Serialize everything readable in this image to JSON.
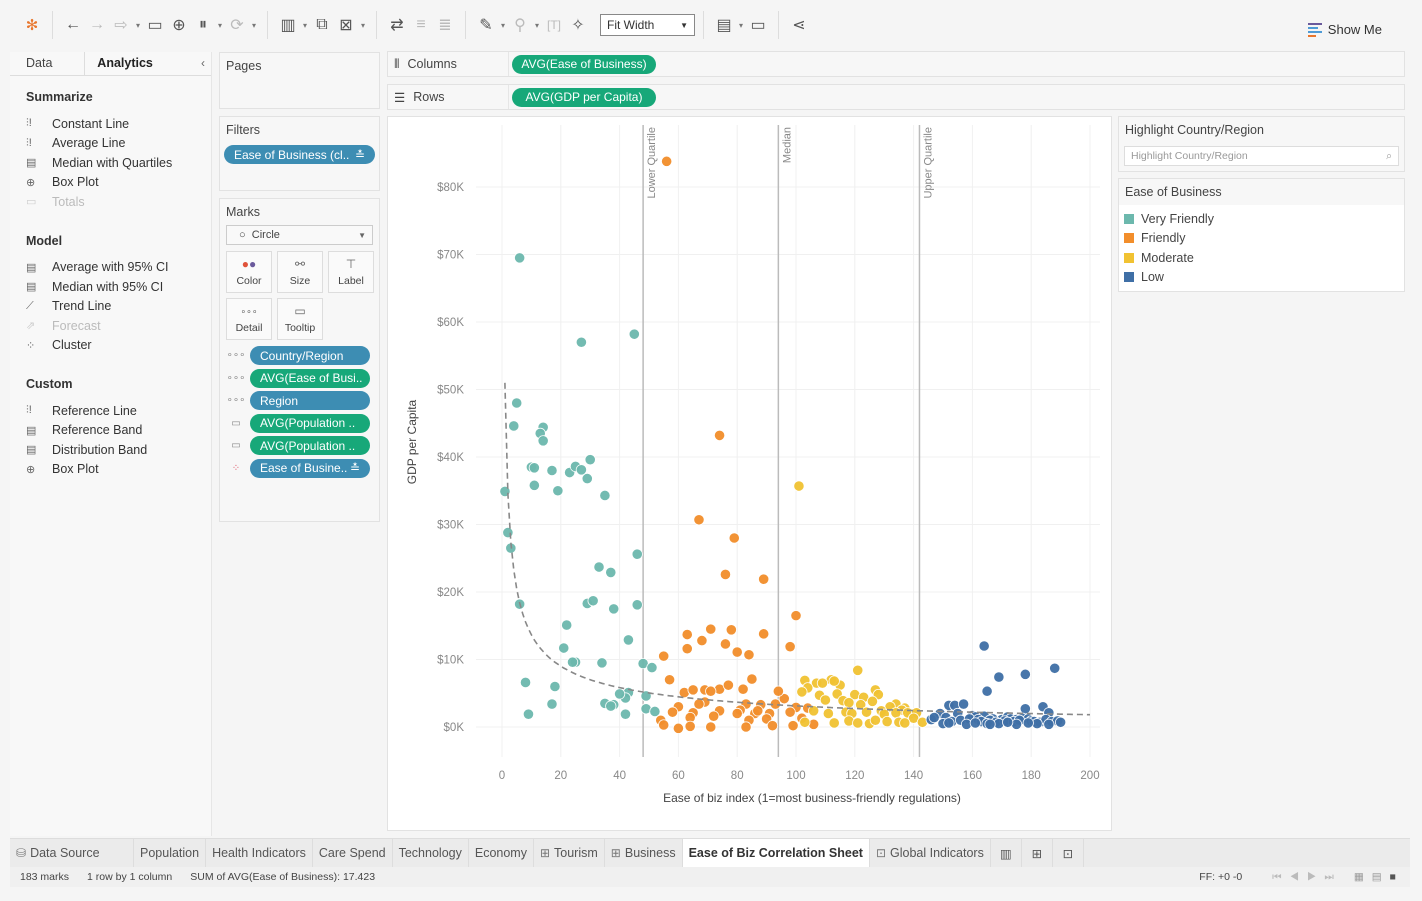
{
  "toolbar": {
    "fit_mode": "Fit Width",
    "show_me_label": "Show Me",
    "icons": [
      "tableau-logo-icon",
      "back-icon",
      "forward-icon",
      "redo-icon",
      "save-icon",
      "new-datasource-icon",
      "pause-datasource-icon",
      "refresh-icon",
      "new-worksheet-icon",
      "duplicate-sheet-icon",
      "clear-sheet-icon",
      "swap-axes-icon",
      "sort-ascending-icon",
      "sort-descending-icon",
      "highlight-icon",
      "group-icon",
      "label-text-icon",
      "pin-icon",
      "show-labels-icon",
      "presentation-icon",
      "share-icon"
    ]
  },
  "left_pane": {
    "tabs": [
      "Data",
      "Analytics"
    ],
    "sections": [
      {
        "title": "Summarize",
        "items": [
          {
            "label": "Constant Line",
            "icon": "constant-line-icon",
            "disabled": false
          },
          {
            "label": "Average Line",
            "icon": "average-line-icon",
            "disabled": false
          },
          {
            "label": "Median with Quartiles",
            "icon": "median-quartiles-icon",
            "disabled": false
          },
          {
            "label": "Box Plot",
            "icon": "box-plot-icon",
            "disabled": false
          },
          {
            "label": "Totals",
            "icon": "totals-icon",
            "disabled": true
          }
        ]
      },
      {
        "title": "Model",
        "items": [
          {
            "label": "Average with 95% CI",
            "icon": "average-ci-icon",
            "disabled": false
          },
          {
            "label": "Median with 95% CI",
            "icon": "median-ci-icon",
            "disabled": false
          },
          {
            "label": "Trend Line",
            "icon": "trend-line-icon",
            "disabled": false
          },
          {
            "label": "Forecast",
            "icon": "forecast-icon",
            "disabled": true
          },
          {
            "label": "Cluster",
            "icon": "cluster-icon",
            "disabled": false
          }
        ]
      },
      {
        "title": "Custom",
        "items": [
          {
            "label": "Reference Line",
            "icon": "reference-line-icon",
            "disabled": false
          },
          {
            "label": "Reference Band",
            "icon": "reference-band-icon",
            "disabled": false
          },
          {
            "label": "Distribution Band",
            "icon": "distribution-band-icon",
            "disabled": false
          },
          {
            "label": "Box Plot",
            "icon": "box-plot-icon",
            "disabled": false
          }
        ]
      }
    ]
  },
  "pages": {
    "title": "Pages"
  },
  "filters": {
    "title": "Filters",
    "items": [
      {
        "label": "Ease of Business (cl..",
        "color": "blue"
      }
    ]
  },
  "marks": {
    "title": "Marks",
    "type": "Circle",
    "buttons": [
      "Color",
      "Size",
      "Label",
      "Detail",
      "Tooltip"
    ],
    "fields": [
      {
        "label": "Country/Region",
        "color": "blue",
        "encoding": "detail"
      },
      {
        "label": "AVG(Ease of Busi..",
        "color": "green",
        "encoding": "detail"
      },
      {
        "label": "Region",
        "color": "blue",
        "encoding": "detail"
      },
      {
        "label": "AVG(Population ..",
        "color": "green",
        "encoding": "tooltip"
      },
      {
        "label": "AVG(Population ..",
        "color": "green",
        "encoding": "tooltip"
      },
      {
        "label": "Ease of Busine..",
        "color": "blue",
        "encoding": "color"
      }
    ]
  },
  "shelves": {
    "columns_label": "Columns",
    "columns_pill": "AVG(Ease of Business)",
    "rows_label": "Rows",
    "rows_pill": "AVG(GDP per Capita)"
  },
  "highlight": {
    "title": "Highlight Country/Region",
    "placeholder": "Highlight Country/Region"
  },
  "legend": {
    "title": "Ease of Business",
    "items": [
      {
        "label": "Very Friendly",
        "color": "#6cb8ad"
      },
      {
        "label": "Friendly",
        "color": "#f28e2b"
      },
      {
        "label": "Moderate",
        "color": "#f1c232"
      },
      {
        "label": "Low",
        "color": "#3f6fa6"
      }
    ]
  },
  "chart_data": {
    "type": "scatter",
    "title": "",
    "xlabel": "Ease of biz index (1=most business-friendly regulations)",
    "ylabel": "GDP per Capita",
    "xlim": [
      -5,
      200
    ],
    "ylim": [
      -4000,
      86000
    ],
    "x_ticks": [
      0,
      20,
      40,
      60,
      80,
      100,
      120,
      140,
      160,
      180,
      200
    ],
    "y_ticks": [
      0,
      10000,
      20000,
      30000,
      40000,
      50000,
      60000,
      70000,
      80000
    ],
    "y_tick_labels": [
      "$0K",
      "$10K",
      "$20K",
      "$30K",
      "$40K",
      "$50K",
      "$60K",
      "$70K",
      "$80K"
    ],
    "x_tick_labels": [
      "0",
      "20",
      "40",
      "60",
      "80",
      "100",
      "120",
      "140",
      "160",
      "180",
      "200"
    ],
    "grid": true,
    "reference_lines": [
      {
        "label": "Lower Quartile",
        "x": 48
      },
      {
        "label": "Median",
        "x": 94
      },
      {
        "label": "Upper Quartile",
        "x": 142
      }
    ],
    "trend_line": {
      "type": "power",
      "style": "dashed",
      "from_x": 1,
      "to_x": 200
    },
    "series": [
      {
        "name": "Very Friendly",
        "color": "#6cb8ad",
        "points": [
          [
            6,
            69500
          ],
          [
            27,
            57000
          ],
          [
            45,
            58200
          ],
          [
            5,
            48000
          ],
          [
            4,
            44600
          ],
          [
            14,
            44400
          ],
          [
            13,
            43500
          ],
          [
            14,
            42400
          ],
          [
            10,
            38500
          ],
          [
            11,
            38400
          ],
          [
            17,
            38000
          ],
          [
            23,
            37700
          ],
          [
            25,
            38600
          ],
          [
            30,
            39600
          ],
          [
            27,
            38100
          ],
          [
            29,
            36800
          ],
          [
            11,
            35800
          ],
          [
            19,
            35000
          ],
          [
            1,
            34900
          ],
          [
            35,
            34300
          ],
          [
            2,
            28800
          ],
          [
            3,
            26500
          ],
          [
            46,
            25600
          ],
          [
            33,
            23700
          ],
          [
            37,
            22900
          ],
          [
            6,
            18200
          ],
          [
            29,
            18300
          ],
          [
            31,
            18700
          ],
          [
            46,
            18100
          ],
          [
            38,
            17500
          ],
          [
            22,
            15100
          ],
          [
            43,
            12900
          ],
          [
            21,
            11700
          ],
          [
            25,
            9600
          ],
          [
            24,
            9600
          ],
          [
            34,
            9500
          ],
          [
            48,
            9400
          ],
          [
            51,
            8800
          ],
          [
            8,
            6600
          ],
          [
            18,
            6000
          ],
          [
            43,
            5100
          ],
          [
            35,
            3500
          ],
          [
            38,
            3300
          ],
          [
            42,
            4300
          ],
          [
            40,
            4900
          ],
          [
            49,
            2700
          ],
          [
            52,
            2300
          ],
          [
            9,
            1900
          ],
          [
            17,
            3400
          ],
          [
            42,
            1900
          ],
          [
            37,
            3100
          ],
          [
            49,
            4600
          ]
        ]
      },
      {
        "name": "Friendly",
        "color": "#f28e2b",
        "points": [
          [
            56,
            83800
          ],
          [
            74,
            43200
          ],
          [
            67,
            30700
          ],
          [
            79,
            28000
          ],
          [
            76,
            22600
          ],
          [
            89,
            21900
          ],
          [
            100,
            16500
          ],
          [
            71,
            14500
          ],
          [
            63,
            13700
          ],
          [
            78,
            14400
          ],
          [
            89,
            13800
          ],
          [
            68,
            12800
          ],
          [
            76,
            12300
          ],
          [
            98,
            11900
          ],
          [
            63,
            11600
          ],
          [
            80,
            11100
          ],
          [
            84,
            10700
          ],
          [
            55,
            10500
          ],
          [
            85,
            7100
          ],
          [
            57,
            7000
          ],
          [
            62,
            5100
          ],
          [
            65,
            5500
          ],
          [
            69,
            5500
          ],
          [
            74,
            5600
          ],
          [
            77,
            6200
          ],
          [
            71,
            5300
          ],
          [
            82,
            5600
          ],
          [
            69,
            3700
          ],
          [
            67,
            3400
          ],
          [
            74,
            2400
          ],
          [
            60,
            3000
          ],
          [
            83,
            3400
          ],
          [
            88,
            3300
          ],
          [
            93,
            3400
          ],
          [
            96,
            4200
          ],
          [
            100,
            2900
          ],
          [
            81,
            2500
          ],
          [
            94,
            5300
          ],
          [
            58,
            2200
          ],
          [
            65,
            2100
          ],
          [
            80,
            2000
          ],
          [
            86,
            2000
          ],
          [
            87,
            2400
          ],
          [
            91,
            2000
          ],
          [
            98,
            2200
          ],
          [
            104,
            2800
          ],
          [
            54,
            1000
          ],
          [
            64,
            1400
          ],
          [
            72,
            1600
          ],
          [
            84,
            1000
          ],
          [
            90,
            1200
          ],
          [
            102,
            1300
          ],
          [
            55,
            300
          ],
          [
            64,
            100
          ],
          [
            71,
            0
          ],
          [
            83,
            0
          ],
          [
            92,
            200
          ],
          [
            99,
            200
          ],
          [
            106,
            400
          ],
          [
            60,
            -200
          ]
        ]
      },
      {
        "name": "Moderate",
        "color": "#f1c232",
        "points": [
          [
            101,
            35700
          ],
          [
            121,
            8400
          ],
          [
            112,
            7000
          ],
          [
            103,
            6900
          ],
          [
            107,
            6500
          ],
          [
            109,
            6500
          ],
          [
            115,
            6200
          ],
          [
            113,
            6800
          ],
          [
            104,
            5800
          ],
          [
            127,
            5500
          ],
          [
            102,
            5200
          ],
          [
            114,
            4900
          ],
          [
            128,
            4800
          ],
          [
            108,
            4700
          ],
          [
            110,
            4000
          ],
          [
            120,
            4800
          ],
          [
            116,
            3900
          ],
          [
            123,
            4400
          ],
          [
            126,
            3800
          ],
          [
            134,
            3400
          ],
          [
            118,
            3600
          ],
          [
            122,
            3300
          ],
          [
            132,
            3000
          ],
          [
            137,
            2800
          ],
          [
            129,
            2400
          ],
          [
            136,
            2500
          ],
          [
            139,
            2000
          ],
          [
            106,
            2400
          ],
          [
            111,
            2000
          ],
          [
            117,
            2200
          ],
          [
            119,
            2000
          ],
          [
            124,
            2200
          ],
          [
            130,
            1900
          ],
          [
            134,
            2100
          ],
          [
            138,
            2100
          ],
          [
            141,
            2100
          ],
          [
            140,
            1300
          ],
          [
            103,
            700
          ],
          [
            113,
            600
          ],
          [
            118,
            900
          ],
          [
            121,
            600
          ],
          [
            125,
            500
          ],
          [
            127,
            1000
          ],
          [
            131,
            800
          ],
          [
            135,
            700
          ],
          [
            137,
            600
          ],
          [
            143,
            700
          ]
        ]
      },
      {
        "name": "Low",
        "color": "#3f6fa6",
        "points": [
          [
            164,
            12000
          ],
          [
            169,
            7400
          ],
          [
            188,
            8700
          ],
          [
            178,
            7800
          ],
          [
            165,
            5300
          ],
          [
            178,
            2700
          ],
          [
            184,
            3000
          ],
          [
            186,
            2100
          ],
          [
            152,
            3200
          ],
          [
            154,
            3200
          ],
          [
            157,
            3400
          ],
          [
            155,
            2000
          ],
          [
            149,
            2000
          ],
          [
            151,
            1400
          ],
          [
            160,
            1700
          ],
          [
            161,
            1500
          ],
          [
            164,
            1600
          ],
          [
            167,
            1200
          ],
          [
            170,
            1100
          ],
          [
            172,
            1500
          ],
          [
            173,
            1200
          ],
          [
            175,
            1100
          ],
          [
            177,
            1300
          ],
          [
            179,
            1200
          ],
          [
            180,
            900
          ],
          [
            181,
            800
          ],
          [
            183,
            700
          ],
          [
            185,
            1100
          ],
          [
            187,
            800
          ],
          [
            189,
            900
          ],
          [
            190,
            700
          ],
          [
            153,
            800
          ],
          [
            156,
            1000
          ],
          [
            159,
            1200
          ],
          [
            162,
            1100
          ],
          [
            163,
            800
          ],
          [
            166,
            1000
          ],
          [
            168,
            700
          ],
          [
            171,
            900
          ],
          [
            174,
            800
          ],
          [
            176,
            1000
          ],
          [
            146,
            1100
          ],
          [
            150,
            500
          ],
          [
            158,
            400
          ],
          [
            165,
            500
          ],
          [
            169,
            500
          ],
          [
            175,
            400
          ],
          [
            182,
            500
          ],
          [
            186,
            400
          ],
          [
            147,
            1400
          ],
          [
            161,
            600
          ],
          [
            166,
            400
          ],
          [
            152,
            600
          ],
          [
            172,
            700
          ],
          [
            179,
            600
          ]
        ]
      }
    ]
  },
  "sheet_tabs": [
    {
      "label": "Data Source",
      "icon": "datasource-icon",
      "active": false
    },
    {
      "label": "Population",
      "icon": "",
      "active": false
    },
    {
      "label": "Health Indicators",
      "icon": "",
      "active": false
    },
    {
      "label": "Care Spend",
      "icon": "",
      "active": false
    },
    {
      "label": "Technology",
      "icon": "",
      "active": false
    },
    {
      "label": "Economy",
      "icon": "",
      "active": false
    },
    {
      "label": "Tourism",
      "icon": "dashboard-icon",
      "active": false
    },
    {
      "label": "Business",
      "icon": "dashboard-icon",
      "active": false
    },
    {
      "label": "Ease of Biz Correlation Sheet",
      "icon": "",
      "active": true
    },
    {
      "label": "Global Indicators",
      "icon": "story-icon",
      "active": false
    }
  ],
  "status_bar": {
    "marks": "183 marks",
    "dims": "1 row by 1 column",
    "sum": "SUM of AVG(Ease of Business): 17.423",
    "ff": "FF: +0 -0"
  }
}
